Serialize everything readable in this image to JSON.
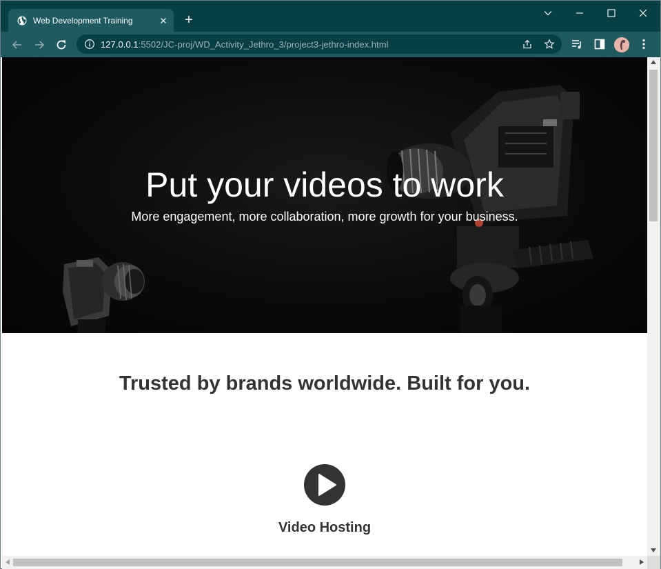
{
  "browser": {
    "tab": {
      "title": "Web Development Training",
      "favicon": "globe-icon",
      "close_icon": "close-icon"
    },
    "new_tab_symbol": "+",
    "window_controls": [
      "chevron-down-icon",
      "minimize-icon",
      "maximize-icon",
      "close-icon"
    ],
    "toolbar": {
      "back": "arrow-left-icon",
      "forward": "arrow-right-icon",
      "reload": "reload-icon",
      "url_host": "127.0.0.1",
      "url_rest": ":5502/JC-proj/WD_Activity_Jethro_3/project3-jethro-index.html",
      "omnibox_icons": [
        "info-icon",
        "share-icon",
        "star-icon"
      ],
      "right_icons": [
        "media-control-icon",
        "side-panel-icon",
        "profile-avatar",
        "more-menu-icon"
      ]
    },
    "colors": {
      "frame": "#073f45",
      "toolbar": "#1e5a60"
    }
  },
  "page": {
    "hero": {
      "title": "Put your videos to work",
      "subtitle": "More engagement, more collaboration, more growth for your business."
    },
    "trust": {
      "heading": "Trusted by brands worldwide. Built for you."
    },
    "features": [
      {
        "icon": "play-circle-icon",
        "title": "Video Hosting"
      }
    ],
    "colors": {
      "heading_text": "#333333",
      "hero_background": "#0b0b0b"
    }
  }
}
